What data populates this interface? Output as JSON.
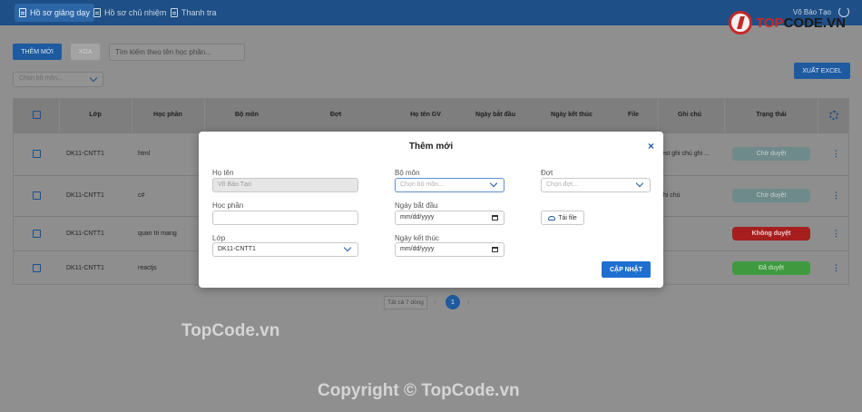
{
  "nav": {
    "tabs": [
      {
        "label": "Hồ sơ giảng dạy",
        "icon": "document-icon",
        "active": true
      },
      {
        "label": "Hồ sơ chủ nhiệm",
        "icon": "document-icon",
        "active": false
      },
      {
        "label": "Thanh tra",
        "icon": "document-icon",
        "active": false
      }
    ],
    "user_name": "Võ Bảo Tạo",
    "user_icon": "user-icon"
  },
  "toolbar": {
    "add_label": "THÊM MỚI",
    "delete_label": "XÓA",
    "search_placeholder": "Tìm kiếm theo tên học phần...",
    "filter_placeholder": "Chọn bộ môn...",
    "export_label": "XUẤT EXCEL"
  },
  "table": {
    "columns": [
      "Lớp",
      "Học phần",
      "Bộ môn",
      "Đợt",
      "Họ tên GV",
      "Ngày bắt đầu",
      "Ngày kết thúc",
      "File",
      "Ghi chú",
      "Trạng thái"
    ],
    "rows": [
      {
        "lop": "DK11-CNTT1",
        "hoc_phan": "html",
        "ghi_chu": "test ghi chú ghi ...",
        "trang_thai": "Chờ duyệt",
        "status_color": "#6f8a8a"
      },
      {
        "lop": "DK11-CNTT1",
        "hoc_phan": "c#",
        "ghi_chu": "ghi chú",
        "trang_thai": "Chờ duyệt",
        "status_color": "#6f8a8a"
      },
      {
        "lop": "DK11-CNTT1",
        "hoc_phan": "quan tri mang",
        "ghi_chu": "",
        "trang_thai": "Không duyệt",
        "status_color": "#a61e1e"
      },
      {
        "lop": "DK11-CNTT1",
        "hoc_phan": "reactjs",
        "ghi_chu": "",
        "trang_thai": "Đã duyệt",
        "status_color": "#3f9a3f"
      }
    ]
  },
  "pagination": {
    "total_label": "Tất cả 7 dòng",
    "prev": "‹",
    "next": "›",
    "current": "1"
  },
  "modal": {
    "title": "Thêm mới",
    "close": "×",
    "ho_ten_label": "Họ tên",
    "ho_ten_value": "Võ Bảo Tạo",
    "bo_mon_label": "Bộ môn",
    "bo_mon_placeholder": "Chọn bộ môn...",
    "dot_label": "Đợt",
    "dot_placeholder": "Chọn đợt...",
    "hoc_phan_label": "Học phần",
    "hoc_phan_value": "",
    "ngay_bat_dau_label": "Ngày bắt đầu",
    "ngay_bat_dau_value": "mm/dd/yyyy",
    "lop_label": "Lớp",
    "lop_value": "DK11-CNTT1",
    "ngay_ket_thuc_label": "Ngày kết thúc",
    "ngay_ket_thuc_value": "mm/dd/yyyy",
    "upload_label": "Tải file",
    "save_label": "CẬP NHẬT"
  },
  "watermarks": {
    "left": "TopCode.vn",
    "bottom": "Copyright © TopCode.vn",
    "logo_prefix": "TOP",
    "logo_suffix": "CODE.VN"
  },
  "colors": {
    "primary": "#1e5aa0",
    "topbar": "#1e4f86",
    "overlay": "#8f8f8f"
  }
}
